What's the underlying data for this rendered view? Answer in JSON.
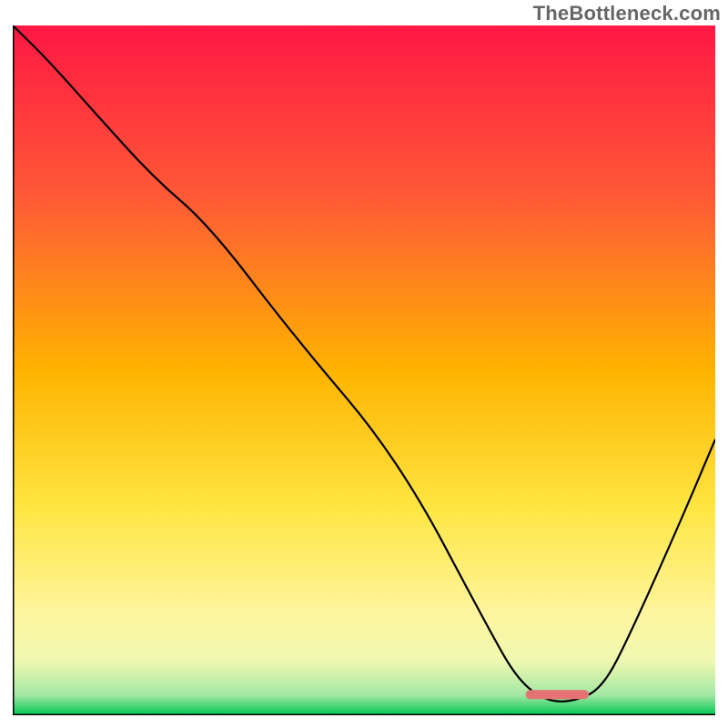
{
  "watermark": "TheBottleneck.com",
  "chart_data": {
    "type": "line",
    "title": "",
    "xlabel": "",
    "ylabel": "",
    "xlim": [
      0,
      100
    ],
    "ylim": [
      0,
      100
    ],
    "gradient_stops": [
      {
        "offset": 0,
        "color": "#ff1744"
      },
      {
        "offset": 25,
        "color": "#ff5a36"
      },
      {
        "offset": 50,
        "color": "#ffb300"
      },
      {
        "offset": 70,
        "color": "#ffe642"
      },
      {
        "offset": 85,
        "color": "#fff59d"
      },
      {
        "offset": 92,
        "color": "#f0f8b0"
      },
      {
        "offset": 97,
        "color": "#a5e8a5"
      },
      {
        "offset": 100,
        "color": "#00c853"
      }
    ],
    "series": [
      {
        "name": "bottleneck-curve",
        "x": [
          0,
          5,
          12,
          20,
          28,
          40,
          55,
          68,
          72,
          76,
          80,
          84,
          88,
          95,
          100
        ],
        "y": [
          100,
          95,
          87,
          78,
          71,
          55,
          37,
          12,
          5,
          2,
          2,
          4,
          12,
          28,
          40
        ]
      }
    ],
    "marker": {
      "present": true,
      "name": "optimal-range-marker",
      "x_start": 73,
      "x_end": 82,
      "y": 3,
      "color": "#e57373"
    },
    "axes": {
      "left": {
        "visible": true,
        "color": "#000000"
      },
      "bottom": {
        "visible": true,
        "color": "#000000"
      }
    }
  }
}
